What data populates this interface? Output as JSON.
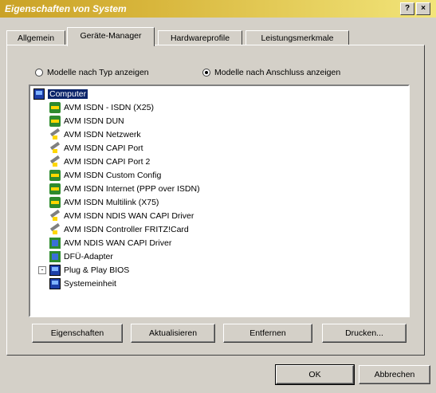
{
  "window": {
    "title": "Eigenschaften von System",
    "help_glyph": "?",
    "close_glyph": "×"
  },
  "tabs": [
    {
      "label": "Allgemein"
    },
    {
      "label": "Geräte-Manager"
    },
    {
      "label": "Hardwareprofile"
    },
    {
      "label": "Leistungsmerkmale"
    }
  ],
  "view_options": {
    "by_type": "Modelle nach Typ anzeigen",
    "by_connection": "Modelle nach Anschluss anzeigen",
    "selected": "by_connection"
  },
  "tree": {
    "root": "Computer",
    "items": [
      {
        "label": "AVM ISDN - ISDN (X25)",
        "icon": "card-icon"
      },
      {
        "label": "AVM ISDN DUN",
        "icon": "card-icon"
      },
      {
        "label": "AVM ISDN Netzwerk",
        "icon": "plug-icon"
      },
      {
        "label": "AVM ISDN CAPI Port",
        "icon": "plug-icon"
      },
      {
        "label": "AVM ISDN CAPI Port 2",
        "icon": "plug-icon"
      },
      {
        "label": "AVM ISDN Custom Config",
        "icon": "card-icon"
      },
      {
        "label": "AVM ISDN Internet (PPP over ISDN)",
        "icon": "card-icon"
      },
      {
        "label": "AVM ISDN Multilink (X75)",
        "icon": "card-icon"
      },
      {
        "label": "AVM ISDN NDIS WAN CAPI Driver",
        "icon": "plug-icon"
      },
      {
        "label": "AVM ISDN Controller FRITZ!Card",
        "icon": "plug-icon"
      },
      {
        "label": "AVM NDIS WAN CAPI Driver",
        "icon": "net-icon"
      },
      {
        "label": "DFÜ-Adapter",
        "icon": "net-icon"
      },
      {
        "label": "Plug & Play BIOS",
        "icon": "cpu-icon",
        "expander": "-"
      },
      {
        "label": "Systemeinheit",
        "icon": "cpu-icon"
      }
    ]
  },
  "buttons": {
    "properties": "Eigenschaften",
    "refresh": "Aktualisieren",
    "remove": "Entfernen",
    "print": "Drucken...",
    "ok": "OK",
    "cancel": "Abbrechen"
  }
}
